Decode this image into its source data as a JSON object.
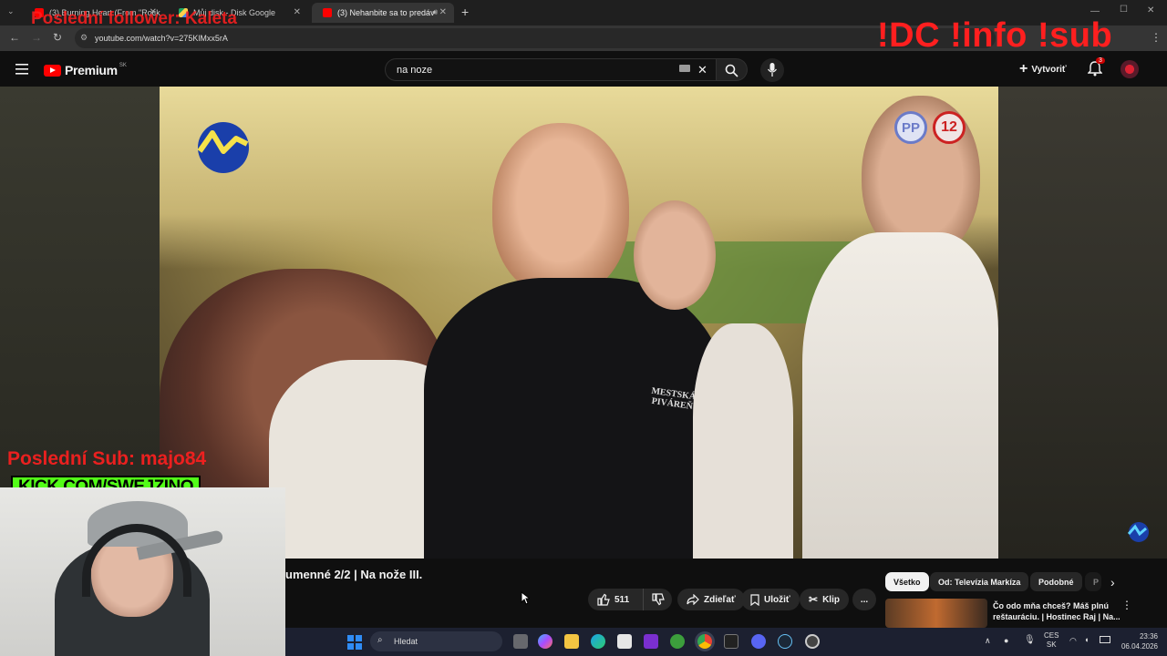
{
  "browser": {
    "tabs": [
      {
        "label": "(3) Burning Heart (From \"Rock",
        "active": false
      },
      {
        "label": "Můj disk - Disk Google",
        "active": false
      },
      {
        "label": "(3) Nehanbite sa to predáv",
        "active": true
      }
    ],
    "url": "youtube.com/watch?v=275KlMxx5rA"
  },
  "youtube": {
    "logo_text": "Premium",
    "logo_region": "SK",
    "search_value": "na noze",
    "create_label": "Vytvoriť",
    "notification_count": "3"
  },
  "stream_overlay": {
    "last_follower": "Poslední follower: Kaleta",
    "commands": "!DC !info !sub",
    "last_sub": "Poslední Sub: majo84",
    "kick_banner": "KICK.COM/SWEJZINO"
  },
  "video": {
    "rating_pp": "PP",
    "rating_age": "12",
    "shirt_text": "MESTSKÁ PIVÁREŇ",
    "title": "umenné 2/2 | Na nože III."
  },
  "actions": {
    "like_count": "511",
    "share_label": "Zdieľať",
    "save_label": "Uložiť",
    "clip_label": "Klip",
    "more_label": "..."
  },
  "chips": [
    {
      "label": "Všetko",
      "active": true
    },
    {
      "label": "Od: Televízia Markíza",
      "active": false
    },
    {
      "label": "Podobné",
      "active": false
    },
    {
      "label": "P",
      "active": false
    }
  ],
  "recommendation": {
    "title": "Čo odo mňa chceš? Máš plnú reštauráciu. | Hostinec Raj | Na..."
  },
  "taskbar": {
    "search_placeholder": "Hledat",
    "lang_top": "CES",
    "lang_bottom": "SK",
    "time": "23:36",
    "date": "06.04.2026"
  },
  "colors": {
    "yt_red": "#ff0000",
    "overlay_red": "#ff1f1f",
    "kick_green": "#53fc18",
    "markiza_blue": "#1a3faa"
  }
}
